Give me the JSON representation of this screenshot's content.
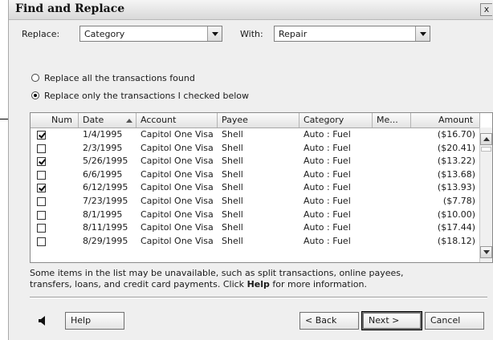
{
  "dialog": {
    "title": "Find and Replace",
    "close_glyph": "x"
  },
  "replace": {
    "label": "Replace:",
    "value": "Category"
  },
  "with": {
    "label": "With:",
    "value": "Repair"
  },
  "options": [
    {
      "label": "Replace all the transactions found",
      "selected": false
    },
    {
      "label": "Replace only the transactions I checked below",
      "selected": true
    }
  ],
  "table": {
    "columns": [
      "Num",
      "Date",
      "Account",
      "Payee",
      "Category",
      "Me...",
      "Amount"
    ],
    "sorted_column": "Date",
    "rows": [
      {
        "checked": true,
        "date": "1/4/1995",
        "account": "Capitol One Visa",
        "payee": "Shell",
        "category": "Auto : Fuel",
        "amount": "($16.70)"
      },
      {
        "checked": false,
        "date": "2/3/1995",
        "account": "Capitol One Visa",
        "payee": "Shell",
        "category": "Auto : Fuel",
        "amount": "($20.41)"
      },
      {
        "checked": true,
        "date": "5/26/1995",
        "account": "Capitol One Visa",
        "payee": "Shell",
        "category": "Auto : Fuel",
        "amount": "($13.22)"
      },
      {
        "checked": false,
        "date": "6/6/1995",
        "account": "Capitol One Visa",
        "payee": "Shell",
        "category": "Auto : Fuel",
        "amount": "($13.68)"
      },
      {
        "checked": true,
        "date": "6/12/1995",
        "account": "Capitol One Visa",
        "payee": "Shell",
        "category": "Auto : Fuel",
        "amount": "($13.93)"
      },
      {
        "checked": false,
        "date": "7/23/1995",
        "account": "Capitol One Visa",
        "payee": "Shell",
        "category": "Auto : Fuel",
        "amount": "($7.78)"
      },
      {
        "checked": false,
        "date": "8/1/1995",
        "account": "Capitol One Visa",
        "payee": "Shell",
        "category": "Auto : Fuel",
        "amount": "($10.00)"
      },
      {
        "checked": false,
        "date": "8/11/1995",
        "account": "Capitol One Visa",
        "payee": "Shell",
        "category": "Auto : Fuel",
        "amount": "($17.44)"
      },
      {
        "checked": false,
        "date": "8/29/1995",
        "account": "Capitol One Visa",
        "payee": "Shell",
        "category": "Auto : Fuel",
        "amount": "($18.12)"
      }
    ]
  },
  "note": {
    "line1": "Some items in the list may be unavailable, such as split transactions, online payees,",
    "line2_pre": "transfers, loans, and credit card payments. Click ",
    "line2_bold": "Help",
    "line2_post": " for more information."
  },
  "buttons": {
    "help": "Help",
    "back": "< Back",
    "next": "Next >",
    "cancel": "Cancel"
  },
  "icons": {
    "speaker": "speaker-icon",
    "close": "close-icon",
    "dropdown": "chevron-down-icon",
    "checkmark": "checkmark-icon"
  }
}
